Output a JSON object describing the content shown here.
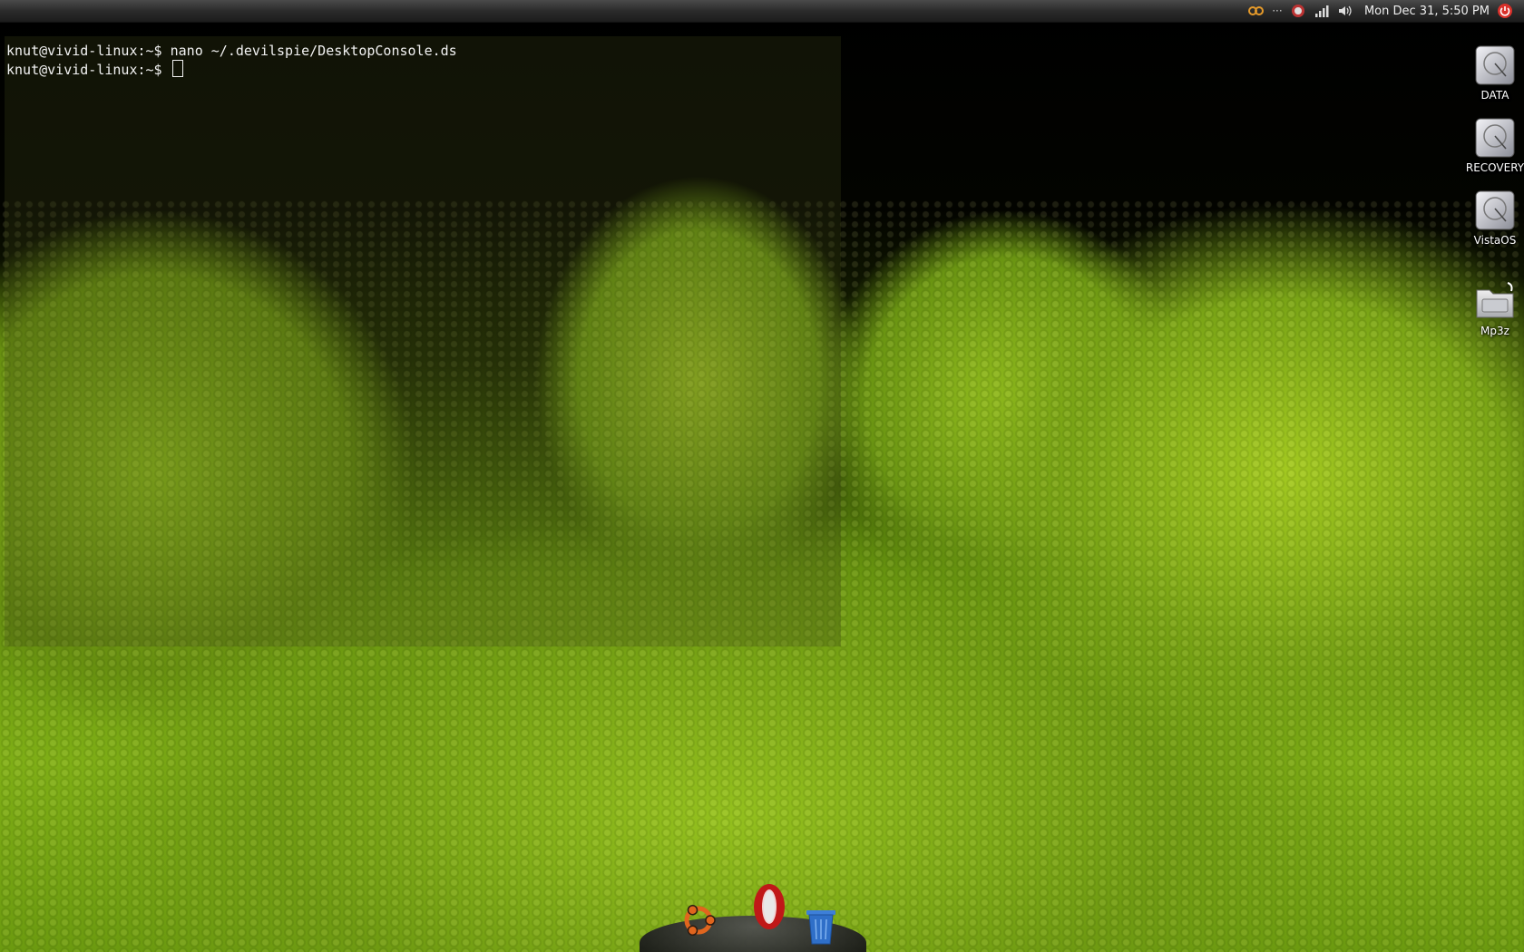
{
  "top_panel": {
    "clock": "Mon Dec 31,  5:50 PM",
    "tray_icons": [
      "network-link-icon",
      "ellipsis-icon",
      "updates-icon",
      "signal-bars-icon",
      "volume-icon",
      "power-icon"
    ]
  },
  "terminal": {
    "lines": [
      "knut@vivid-linux:~$ nano ~/.devilspie/DesktopConsole.ds",
      "knut@vivid-linux:~$ "
    ]
  },
  "desktop_icons": [
    {
      "label": "DATA",
      "icon": "drive-icon"
    },
    {
      "label": "RECOVERY",
      "icon": "drive-icon"
    },
    {
      "label": "VistaOS",
      "icon": "drive-icon"
    },
    {
      "label": "Mp3z",
      "icon": "folder-link-icon"
    }
  ],
  "dock": {
    "items": [
      "ubuntu-logo-icon",
      "opera-browser-icon",
      "trash-icon"
    ]
  },
  "colors": {
    "panel": "#2b2b2b",
    "snake_green": "#8dba1c",
    "terminal_text": "#f2f2f2",
    "power_red": "#d9302a"
  }
}
